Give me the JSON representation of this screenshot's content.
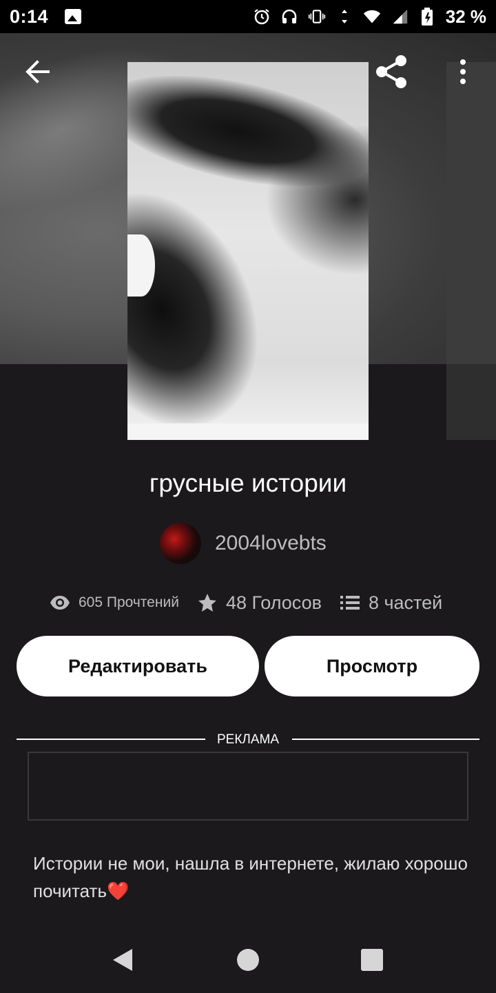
{
  "status_bar": {
    "time": "0:14",
    "battery_text": "32 %",
    "icons": [
      "gallery-icon",
      "alarm-icon",
      "headphones-icon",
      "vibrate-icon",
      "data-arrows-icon",
      "wifi-icon",
      "signal-icon",
      "battery-icon"
    ]
  },
  "header": {
    "back_icon": "arrow-left-icon",
    "share_icon": "share-icon",
    "more_icon": "more-vertical-icon"
  },
  "story": {
    "title": "грусные истории",
    "author": "2004lovebts",
    "stats": {
      "reads": "605 Прочтений",
      "votes": "48 Голосов",
      "parts": "8 частей"
    },
    "description": "Истории не мои, нашла в интернете, жилаю хорошо почитать❤️"
  },
  "buttons": {
    "edit_label": "Редактировать",
    "view_label": "Просмотр"
  },
  "ad": {
    "label": "РЕКЛАМА"
  },
  "nav": {
    "icons": [
      "nav-back-icon",
      "nav-home-icon",
      "nav-recents-icon"
    ]
  }
}
